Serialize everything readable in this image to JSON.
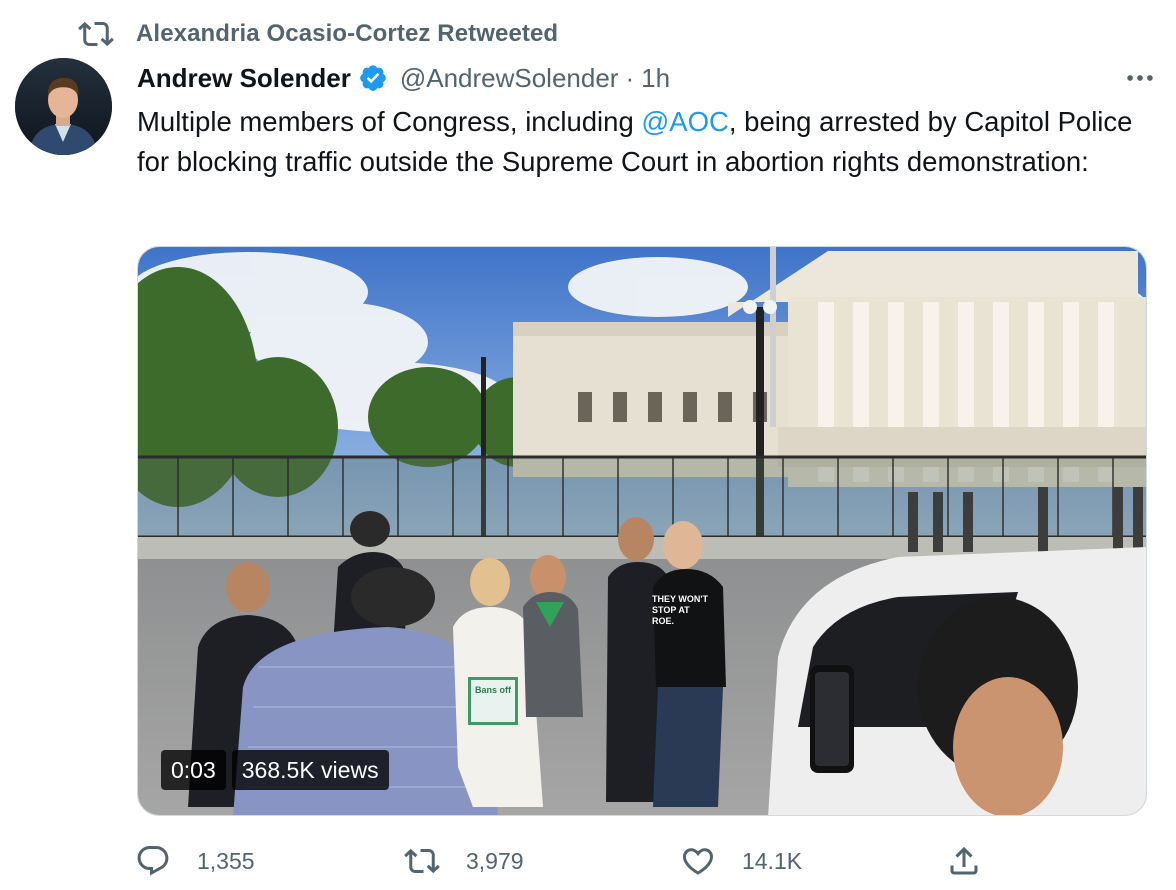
{
  "retweet": {
    "text": "Alexandria Ocasio-Cortez Retweeted",
    "icon": "retweet-icon"
  },
  "author": {
    "name": "Andrew Solender",
    "handle": "@AndrewSolender",
    "separator": "·",
    "time": "1h",
    "verified_icon": "verified-badge-icon",
    "avatar": "profile-photo"
  },
  "tweet": {
    "text_before": "Multiple members of Congress, including ",
    "mention": "@AOC",
    "text_after": ", being arrested by Capitol Police for blocking traffic outside the Supreme Court in abortion rights demonstration:"
  },
  "media": {
    "duration": "0:03",
    "views": "368.5K views",
    "sign_text": "Bans off",
    "shirt_text": "THEY WON'T\nSTOP AT\nROE."
  },
  "actions": {
    "reply_count": "1,355",
    "retweet_count": "3,979",
    "like_count": "14.1K"
  },
  "colors": {
    "text": "#0f1419",
    "secondary": "#536471",
    "link": "#1d9bf0",
    "border": "#cfd9de"
  }
}
